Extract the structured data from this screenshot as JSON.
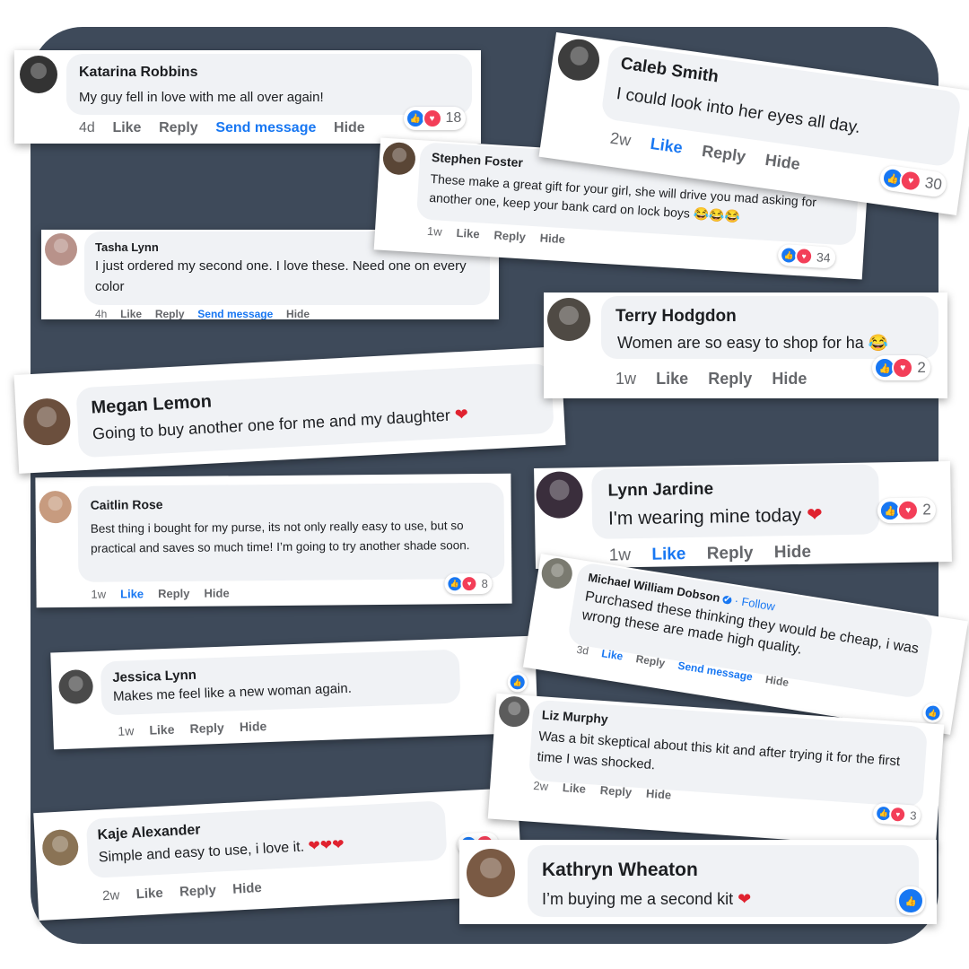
{
  "comments": [
    {
      "name": "Katarina Robbins",
      "text": "My guy fell in love with me all over again!",
      "time": "4d",
      "actions": [
        "Like",
        "Reply",
        "Send message",
        "Hide"
      ],
      "reactions": "18"
    },
    {
      "name": "Caleb Smith",
      "text": "I could look into her eyes all day.",
      "time": "2w",
      "actions": [
        "Like",
        "Reply",
        "Hide"
      ],
      "reactions": "30"
    },
    {
      "name": "Stephen Foster",
      "text": "These make a great gift for your girl, she will drive you mad asking for another one, keep your bank card on lock boys 😂😂😂",
      "time": "1w",
      "actions": [
        "Like",
        "Reply",
        "Hide"
      ],
      "reactions": "34"
    },
    {
      "name": "Tasha Lynn",
      "text": "I just ordered my second one. I love these. Need one on every color",
      "time": "4h",
      "actions": [
        "Like",
        "Reply",
        "Send message",
        "Hide"
      ]
    },
    {
      "name": "Terry Hodgdon",
      "text": "Women are so easy to shop for ha 😂",
      "time": "1w",
      "actions": [
        "Like",
        "Reply",
        "Hide"
      ],
      "reactions": "2"
    },
    {
      "name": "Megan Lemon",
      "text": "Going to buy another one for me and my daughter",
      "heart": "❤"
    },
    {
      "name": "Caitlin Rose",
      "text": "Best thing i bought for my purse, its not only really easy to use, but so practical and saves so much time! I’m going to try another shade soon.",
      "time": "1w",
      "actions": [
        "Like",
        "Reply",
        "Hide"
      ],
      "reactions": "8"
    },
    {
      "name": "Lynn Jardine",
      "text": "I'm wearing mine today",
      "heart": "❤",
      "time": "1w",
      "actions": [
        "Like",
        "Reply",
        "Hide"
      ],
      "reactions": "2"
    },
    {
      "name": "Michael William Dobson",
      "follow": "· Follow",
      "text": "Purchased these thinking they would be cheap, i was wrong these are made high quality.",
      "time": "3d",
      "actions": [
        "Like",
        "Reply",
        "Send message",
        "Hide"
      ]
    },
    {
      "name": "Jessica Lynn",
      "text": "Makes me feel like a new woman again.",
      "time": "1w",
      "actions": [
        "Like",
        "Reply",
        "Hide"
      ]
    },
    {
      "name": "Liz Murphy",
      "text": "Was a bit skeptical about this kit and after trying it for the first time I was shocked.",
      "time": "2w",
      "actions": [
        "Like",
        "Reply",
        "Hide"
      ],
      "reactions": "3"
    },
    {
      "name": "Kaje Alexander",
      "text": "Simple and easy to use, i love it.",
      "heart": "❤❤❤",
      "time": "2w",
      "actions": [
        "Like",
        "Reply",
        "Hide"
      ]
    },
    {
      "name": "Kathryn Wheaton",
      "text": "I’m buying me a second kit",
      "heart": "❤"
    }
  ],
  "icons": {
    "like": "thumbs-up-icon",
    "love": "heart-icon",
    "verified": "verified-badge-icon"
  },
  "colors": {
    "background": "#3e4a5a",
    "bubble": "#f0f2f5",
    "like_blue": "#1877f2",
    "love_red": "#f33e58",
    "heart": "#e0222f"
  }
}
